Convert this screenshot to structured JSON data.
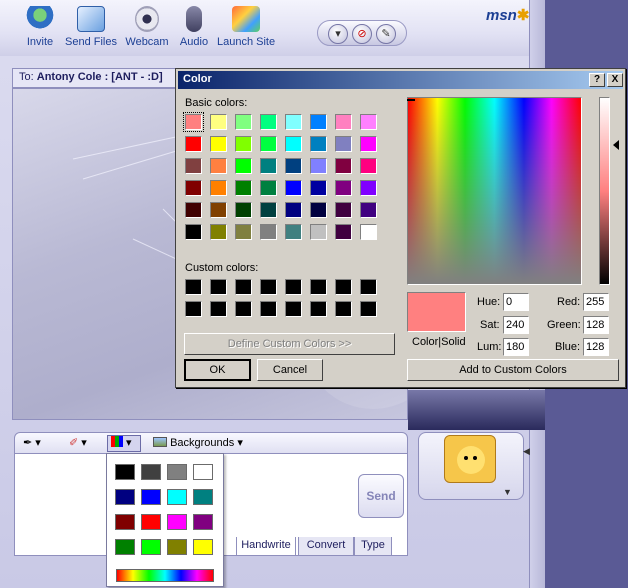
{
  "toolbar": {
    "buttons": [
      {
        "label": "Invite",
        "icon": "invite-icon"
      },
      {
        "label": "Send Files",
        "icon": "send-files-icon"
      },
      {
        "label": "Webcam",
        "icon": "webcam-icon"
      },
      {
        "label": "Audio",
        "icon": "audio-icon"
      },
      {
        "label": "Launch Site",
        "icon": "launch-site-icon"
      }
    ],
    "logo": "msn",
    "round_buttons": [
      "chevron-down-icon",
      "block-icon",
      "paint-icon"
    ]
  },
  "conversation": {
    "to_label": "To:",
    "to_value": "Antony Cole : [ANT - :D]"
  },
  "compose": {
    "backgrounds_label": "Backgrounds",
    "send_label": "Send",
    "tabs": [
      "Handwrite",
      "Convert",
      "Type"
    ]
  },
  "color_menu": {
    "colors": [
      "#000000",
      "#404040",
      "#808080",
      "#ffffff",
      "#000080",
      "#0000ff",
      "#00ffff",
      "#008080",
      "#800000",
      "#ff0000",
      "#ff00ff",
      "#800080",
      "#008000",
      "#00ff00",
      "#808000",
      "#ffff00"
    ]
  },
  "dialog": {
    "title": "Color",
    "help_label": "?",
    "close_label": "X",
    "basic_colors_label": "Basic colors:",
    "basic_colors": [
      "#ff8080",
      "#ffff80",
      "#80ff80",
      "#00ff80",
      "#80ffff",
      "#0080ff",
      "#ff80c0",
      "#ff80ff",
      "#ff0000",
      "#ffff00",
      "#80ff00",
      "#00ff40",
      "#00ffff",
      "#0080c0",
      "#8080c0",
      "#ff00ff",
      "#804040",
      "#ff8040",
      "#00ff00",
      "#008080",
      "#004080",
      "#8080ff",
      "#800040",
      "#ff0080",
      "#800000",
      "#ff8000",
      "#008000",
      "#008040",
      "#0000ff",
      "#0000a0",
      "#800080",
      "#8000ff",
      "#400000",
      "#804000",
      "#004000",
      "#004040",
      "#000080",
      "#000040",
      "#400040",
      "#400080",
      "#000000",
      "#808000",
      "#808040",
      "#808080",
      "#408080",
      "#c0c0c0",
      "#400040",
      "#ffffff"
    ],
    "custom_colors_label": "Custom colors:",
    "custom_colors": [
      "#000000",
      "#000000",
      "#000000",
      "#000000",
      "#000000",
      "#000000",
      "#000000",
      "#000000",
      "#000000",
      "#000000",
      "#000000",
      "#000000",
      "#000000",
      "#000000",
      "#000000",
      "#000000"
    ],
    "define_custom_label": "Define Custom Colors >>",
    "ok_label": "OK",
    "cancel_label": "Cancel",
    "color_solid_label": "Color|Solid",
    "add_custom_label": "Add to Custom Colors",
    "hue_label": "Hue:",
    "sat_label": "Sat:",
    "lum_label": "Lum:",
    "red_label": "Red:",
    "green_label": "Green:",
    "blue_label": "Blue:",
    "hue": "0",
    "sat": "240",
    "lum": "180",
    "red": "255",
    "green": "128",
    "blue": "128",
    "preview_color": "#ff8080"
  }
}
